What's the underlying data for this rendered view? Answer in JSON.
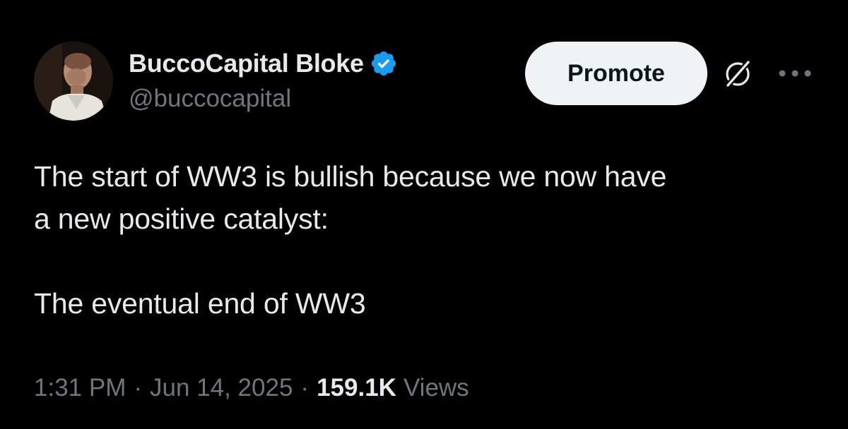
{
  "colors": {
    "background": "#000000",
    "primary_text": "#e7e9ea",
    "secondary_text": "#71767b",
    "verified_blue": "#1d9bf0",
    "button_bg": "#eff3f4",
    "button_text": "#0f1419"
  },
  "author": {
    "display_name": "BuccoCapital Bloke",
    "handle": "@buccocapital",
    "verified": true,
    "avatar_icon": "profile-photo"
  },
  "actions": {
    "promote_label": "Promote",
    "grok_icon": "grok-icon",
    "more_icon": "more-horizontal-icon"
  },
  "tweet": {
    "line1": "The start of WW3 is bullish because we now have",
    "line2": "a new positive catalyst:",
    "line3": "The eventual end of WW3"
  },
  "meta": {
    "time": "1:31 PM",
    "separator": "·",
    "date": "Jun 14, 2025",
    "views_count": "159.1K",
    "views_label": "Views"
  }
}
